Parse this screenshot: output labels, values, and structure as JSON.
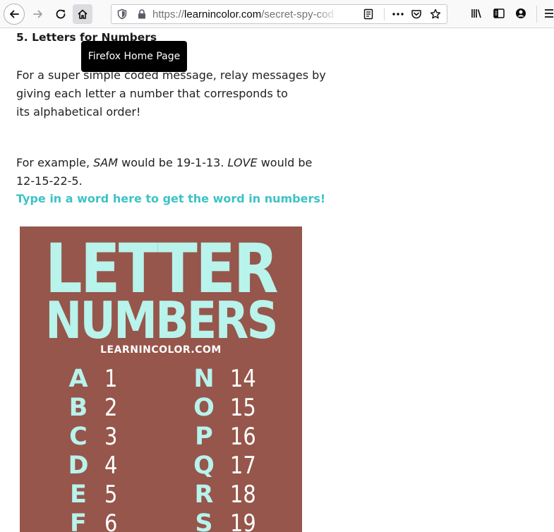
{
  "browser": {
    "url_prefix": "https://",
    "url_host": "learnincolor.com",
    "url_path": "/secret-spy-cod",
    "home_tooltip": "Firefox Home Page"
  },
  "page": {
    "heading": "5. Letters for Numbers",
    "para1_lines": [
      "For a super simple coded message, relay messages by",
      "giving each letter a number that corresponds to",
      "its alphabetical order!"
    ],
    "para2": {
      "pre1": "For example, ",
      "ex1": "SAM",
      "mid": " would be 19-1-13. ",
      "ex2": "LOVE",
      "post": " would be",
      "line2": "12-15-22-5."
    },
    "cta": "Type in a word here to get the word in numbers!"
  },
  "infographic": {
    "title_line1": "LETTER",
    "title_line2": "NUMBERS",
    "site": "LEARNINCOLOR.COM",
    "left_column": [
      {
        "letter": "A",
        "number": "1"
      },
      {
        "letter": "B",
        "number": "2"
      },
      {
        "letter": "C",
        "number": "3"
      },
      {
        "letter": "D",
        "number": "4"
      },
      {
        "letter": "E",
        "number": "5"
      },
      {
        "letter": "F",
        "number": "6"
      }
    ],
    "right_column": [
      {
        "letter": "N",
        "number": "14"
      },
      {
        "letter": "O",
        "number": "15"
      },
      {
        "letter": "P",
        "number": "16"
      },
      {
        "letter": "Q",
        "number": "17"
      },
      {
        "letter": "R",
        "number": "18"
      },
      {
        "letter": "S",
        "number": "19"
      }
    ],
    "colors": {
      "background": "#96564b",
      "letters": "#b8f3ec",
      "numbers": "#ffffff"
    }
  },
  "colors": {
    "link": "#3cc3c6",
    "tooltip_bg": "#000000"
  }
}
